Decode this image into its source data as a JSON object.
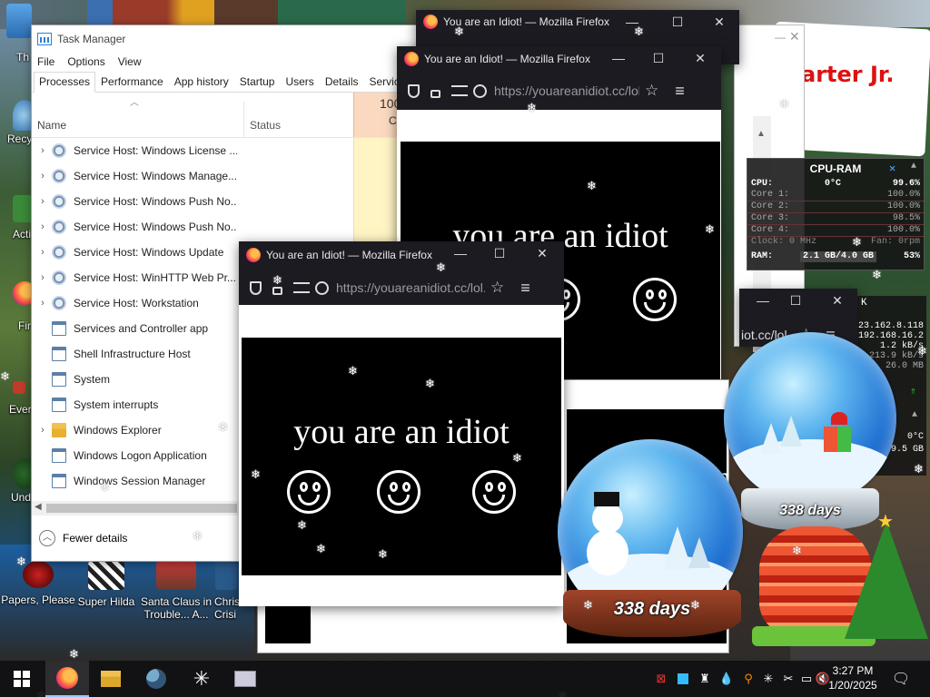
{
  "desktop": {
    "icons": [
      {
        "label": "Th",
        "name": "desktop-icon-th"
      },
      {
        "label": "Recy",
        "name": "desktop-icon-recycle"
      },
      {
        "label": "Acti",
        "name": "desktop-icon-acti"
      },
      {
        "label": "Fir",
        "name": "desktop-icon-firefox"
      },
      {
        "label": "Ever",
        "name": "desktop-icon-ever"
      },
      {
        "label": "Und",
        "name": "desktop-icon-und"
      },
      {
        "label": "Papers, Please",
        "name": "desktop-icon-papers-please"
      },
      {
        "label": "Super Hilda",
        "name": "desktop-icon-super-hilda"
      },
      {
        "label": "Santa Claus in Trouble... A...",
        "name": "desktop-icon-santa-claus"
      },
      {
        "label": "Chris",
        "name": "desktop-icon-chris"
      },
      {
        "label": "Crisi",
        "name": "desktop-icon-crisi"
      }
    ],
    "banner_text": "arter Jr."
  },
  "task_manager": {
    "title": "Task Manager",
    "menu": [
      "File",
      "Options",
      "View"
    ],
    "tabs": [
      "Processes",
      "Performance",
      "App history",
      "Startup",
      "Users",
      "Details",
      "Services"
    ],
    "active_tab": "Processes",
    "columns": {
      "name": "Name",
      "status": "Status",
      "cpu": "100",
      "cpu_sub": "C"
    },
    "rows": [
      {
        "name": "Service Host: Windows License ...",
        "expand": true,
        "icon": "gear-icon"
      },
      {
        "name": "Service Host: Windows Manage...",
        "expand": true,
        "icon": "gear-icon"
      },
      {
        "name": "Service Host: Windows Push No...",
        "expand": true,
        "icon": "gear-icon"
      },
      {
        "name": "Service Host: Windows Push No...",
        "expand": true,
        "icon": "gear-icon"
      },
      {
        "name": "Service Host: Windows Update",
        "expand": true,
        "icon": "gear-icon"
      },
      {
        "name": "Service Host: WinHTTP Web Pr...",
        "expand": true,
        "icon": "gear-icon"
      },
      {
        "name": "Service Host: Workstation",
        "expand": true,
        "icon": "gear-icon"
      },
      {
        "name": "Services and Controller app",
        "expand": false,
        "icon": "window-icon"
      },
      {
        "name": "Shell Infrastructure Host",
        "expand": false,
        "icon": "window-icon"
      },
      {
        "name": "System",
        "expand": false,
        "icon": "window-icon"
      },
      {
        "name": "System interrupts",
        "expand": false,
        "icon": "window-icon"
      },
      {
        "name": "Windows Explorer",
        "expand": true,
        "icon": "folder-icon"
      },
      {
        "name": "Windows Logon Application",
        "expand": false,
        "icon": "window-icon"
      },
      {
        "name": "Windows Session Manager",
        "expand": false,
        "icon": "window-icon"
      }
    ],
    "footer": "Fewer details"
  },
  "firefox": {
    "title": "You are an Idiot! — Mozilla Firefox",
    "url": "https://youareanidiot.cc/lol.",
    "url_short": "iot.cc/lol",
    "message": "you are an idiot"
  },
  "cpu_gadget": {
    "title": "CPU-RAM",
    "cpu_label": "CPU:",
    "cpu_temp": "0°C",
    "cpu_total": "99.6%",
    "cores": [
      {
        "label": "Core 1:",
        "value": "100.0%"
      },
      {
        "label": "Core 2:",
        "value": "100.0%"
      },
      {
        "label": "Core 3:",
        "value": "98.5%"
      },
      {
        "label": "Core 4:",
        "value": "100.0%"
      }
    ],
    "clock": "Clock: 0 MHz",
    "fan": "Fan: 0rpm",
    "ram_label": "RAM:",
    "ram_value": "2.1 GB/4.0 GB",
    "ram_pct": "53%"
  },
  "network_gadget": {
    "ip1": "23.162.8.118",
    "ip2": "192.168.16.2",
    "rate1": "1.2 kB/s",
    "rate2": "213.9 kB/s",
    "rate3": "26.0 MB",
    "temp": "0°C",
    "storage": "9.5 GB",
    "k": "K"
  },
  "globes": {
    "days_front": "338 days",
    "days_back": "338 days"
  },
  "background_text": "n",
  "taskbar": {
    "time": "3:27 PM",
    "date": "1/20/2025"
  }
}
